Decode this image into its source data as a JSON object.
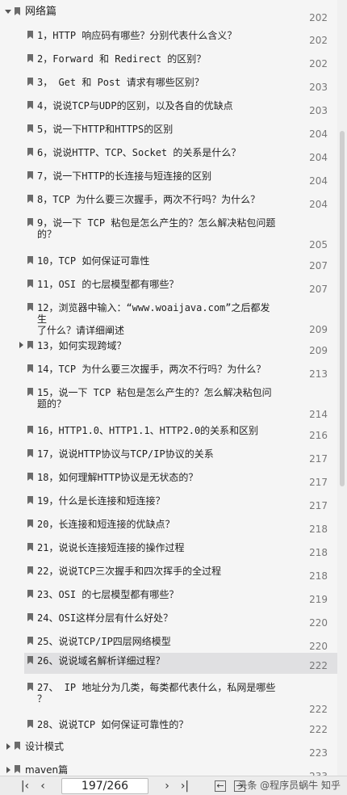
{
  "section": {
    "title": "网络篇",
    "page": "202"
  },
  "items": [
    {
      "label": "1，HTTP 响应码有哪些？分别代表什么含义？",
      "page": "202"
    },
    {
      "label": "2，Forward 和 Redirect 的区别？",
      "page": "202"
    },
    {
      "label": "3， Get 和 Post 请求有哪些区别？",
      "page": "203"
    },
    {
      "label": "4，说说TCP与UDP的区别，以及各自的优缺点",
      "page": "203"
    },
    {
      "label": "5，说一下HTTP和HTTPS的区别",
      "page": "204"
    },
    {
      "label": "6，说说HTTP、TCP、Socket 的关系是什么？",
      "page": "204"
    },
    {
      "label": "7，说一下HTTP的长连接与短连接的区别",
      "page": "204"
    },
    {
      "label": "8，TCP 为什么要三次握手，两次不行吗？为什么？",
      "page": "204"
    },
    {
      "label": "9，说一下 TCP 粘包是怎么产生的？怎么解决粘包问题\n的？",
      "page": "205"
    },
    {
      "label": "10，TCP 如何保证可靠性",
      "page": "207"
    },
    {
      "label": "11，OSI 的七层模型都有哪些？",
      "page": "207"
    },
    {
      "label": "12，浏览器中输入：“www.woaijava.com”之后都发生\n了什么？请详细阐述",
      "page": "209"
    },
    {
      "label": "13，如何实现跨域？",
      "page": "209"
    },
    {
      "label": "14，TCP 为什么要三次握手，两次不行吗？为什么？",
      "page": "213"
    },
    {
      "label": "15，说一下 TCP 粘包是怎么产生的？怎么解决粘包问\n题的？",
      "page": "214"
    },
    {
      "label": "16，HTTP1.0、HTTP1.1、HTTP2.0的关系和区别",
      "page": "216"
    },
    {
      "label": "17，说说HTTP协议与TCP/IP协议的关系",
      "page": "217"
    },
    {
      "label": "18，如何理解HTTP协议是无状态的？",
      "page": "217"
    },
    {
      "label": "19，什么是长连接和短连接？",
      "page": "217"
    },
    {
      "label": "20，长连接和短连接的优缺点？",
      "page": "218"
    },
    {
      "label": "21，说说长连接短连接的操作过程",
      "page": "218"
    },
    {
      "label": "22，说说TCP三次握手和四次挥手的全过程",
      "page": "218"
    },
    {
      "label": "23、OSI 的七层模型都有哪些？",
      "page": "219"
    },
    {
      "label": "24、OSI这样分层有什么好处？",
      "page": "220"
    },
    {
      "label": "25、说说TCP/IP四层网络模型",
      "page": "220"
    },
    {
      "label": "26、说说域名解析详细过程？",
      "page": "222"
    },
    {
      "label": "27、 IP 地址分为几类，每类都代表什么，私网是哪些\n？",
      "page": "222"
    },
    {
      "label": "28、说说TCP 如何保证可靠性的？",
      "page": "222"
    }
  ],
  "bottom_sections": [
    {
      "title": "设计模式",
      "page": "223"
    },
    {
      "title": "maven篇",
      "page": "233"
    }
  ],
  "toolbar": {
    "first_icon": "first-page-icon",
    "prev_icon": "prev-page-icon",
    "page_indicator": "197/266",
    "next_icon": "next-page-icon",
    "last_icon": "last-page-icon",
    "back_icon": "back-icon",
    "forward_icon": "forward-icon",
    "watermark": "头条 @程序员蜗牛 知乎"
  }
}
